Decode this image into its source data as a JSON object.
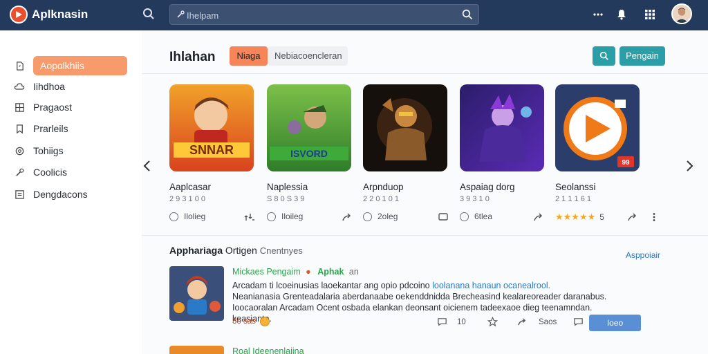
{
  "topbar": {
    "title": "Aplknasin",
    "search_placeholder": "Ihelpam"
  },
  "sidebar": {
    "items": [
      {
        "label": "Aopolkhiis",
        "icon": "document-icon",
        "active": true
      },
      {
        "label": "Iihdhoa",
        "icon": "cloud-icon",
        "active": false
      },
      {
        "label": "Pragaost",
        "icon": "grid-icon",
        "active": false
      },
      {
        "label": "Prarleils",
        "icon": "bookmark-icon",
        "active": false
      },
      {
        "label": "Tohiigs",
        "icon": "settings-icon",
        "active": false
      },
      {
        "label": "Coolicis",
        "icon": "tools-icon",
        "active": false
      },
      {
        "label": "Dengdacons",
        "icon": "list-icon",
        "active": false
      }
    ]
  },
  "main": {
    "title": "Ihlahan",
    "tabs": [
      {
        "label": "Niaga"
      },
      {
        "label": "Nebiacoencleran"
      }
    ],
    "primary_button": "Pengain",
    "apps": [
      {
        "name": "Aaplcasar",
        "meta": "2 9 3 1 0 0",
        "likes": "Ilolieg",
        "thumb_text": "SNNAR"
      },
      {
        "name": "Naplessia",
        "meta": "S 8 0 S 3 9",
        "likes": "Iloileg",
        "thumb_text": "ISVORD"
      },
      {
        "name": "Arpnduop",
        "meta": "2 2 0 1 0 1",
        "likes": "2oleg",
        "thumb_text": ""
      },
      {
        "name": "Aspaiag dorg",
        "meta": "3 9 3 1 0",
        "likes": "6tlea",
        "thumb_text": ""
      },
      {
        "name": "Seolanssi",
        "meta": "2 1 1 1 6 1",
        "likes": "5",
        "stars": "★★★★★",
        "thumb_text": "99"
      }
    ],
    "section": {
      "title": "Apphariaga",
      "title_sub": "Ortigen",
      "title_tail": "Cnentnyes",
      "link": "Asppoiair"
    },
    "review": {
      "user": "Mickaes Pengaim",
      "badge": "Aphak",
      "small": "an",
      "body_1": "Arcadam ti lcoeinusias laoekantar ang opio pdcoino",
      "body_1_hl": "loolanana hanaun ocanealrool.",
      "body_2": "Neanianasia Grenteadalaria aberdanaabe oekenddnidda Brecheasind kealareoreader daranabus.",
      "body_3": "Ioocaoralan Arcadam Ocent osbada elankan deonsant oicienem tadeexaoe dieg teenamndan. keasiante.",
      "date": "3o sas",
      "comments": "10",
      "save_label": "Saos",
      "reply_button": "Ioeo"
    },
    "next_review": {
      "user": "Roal Ideenenlaiina"
    }
  }
}
